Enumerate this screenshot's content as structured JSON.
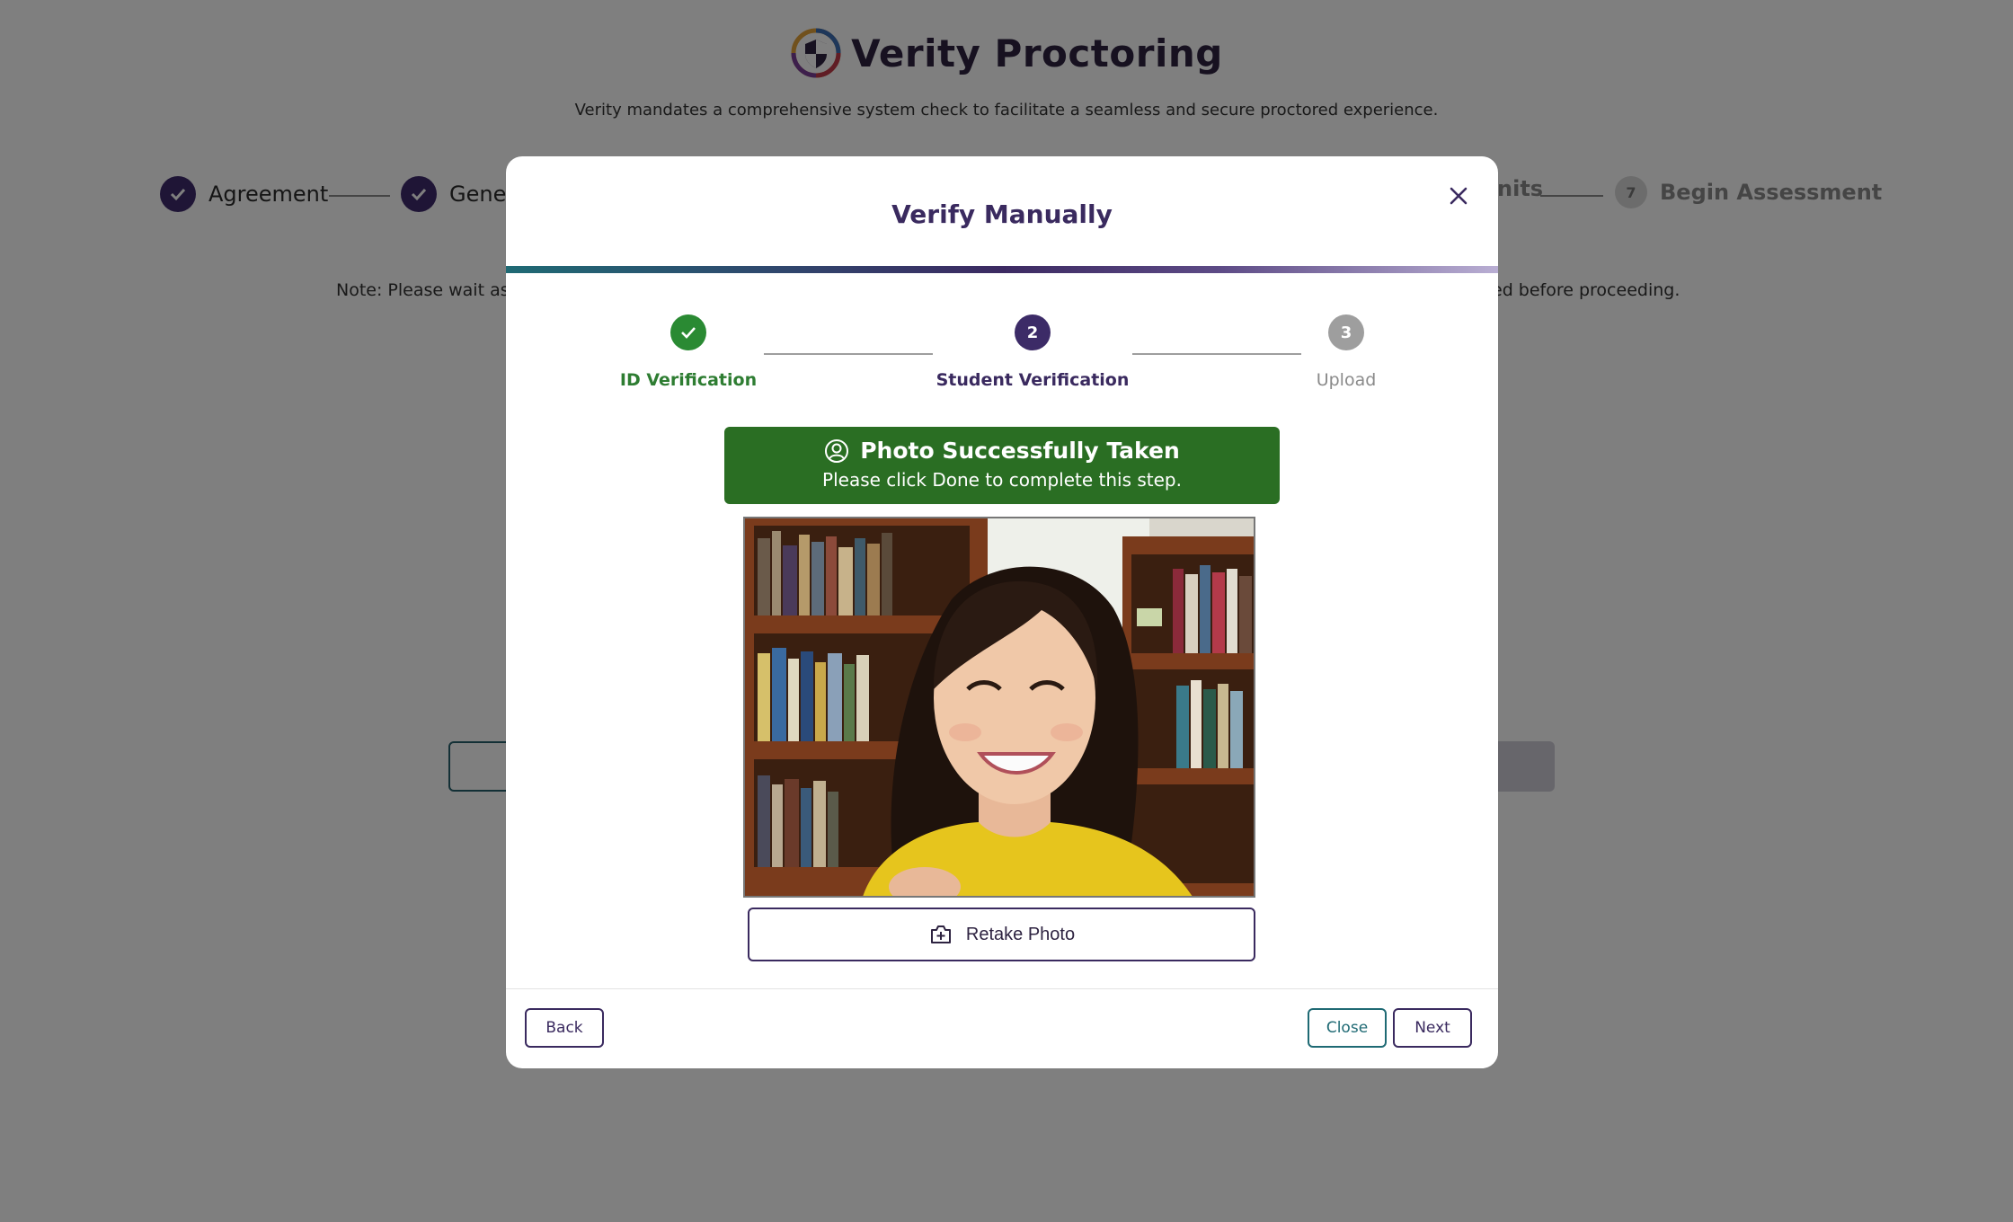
{
  "background": {
    "brand_name": "Verity Proctoring",
    "subtitle": "Verity mandates a comprehensive system check to facilitate a seamless and secure proctored experience.",
    "steps": [
      {
        "label": "Agreement",
        "state": "done"
      },
      {
        "label": "Gener",
        "state": "done"
      },
      {
        "label": "nits",
        "state": "partial"
      },
      {
        "label": "Begin Assessment",
        "number": "7",
        "state": "pending"
      }
    ],
    "note_left": "Note: Please wait as Ve",
    "note_right": "ed before proceeding."
  },
  "modal": {
    "title": "Verify Manually",
    "close_icon": "close-icon",
    "steps": [
      {
        "label": "ID Verification",
        "number": "1",
        "state": "done"
      },
      {
        "label": "Student Verification",
        "number": "2",
        "state": "active"
      },
      {
        "label": "Upload",
        "number": "3",
        "state": "pending"
      }
    ],
    "banner": {
      "icon": "user-circle-icon",
      "title": "Photo Successfully Taken",
      "subtitle": "Please click Done to complete this step."
    },
    "photo": {
      "description": "captured-student-photo"
    },
    "retake_button": {
      "label": "Retake Photo",
      "icon": "camera-plus-icon"
    },
    "footer": {
      "back_label": "Back",
      "close_label": "Close",
      "next_label": "Next"
    }
  },
  "colors": {
    "brand_purple": "#3a2a5f",
    "success_green": "#2a6e23",
    "step_done_green": "#2a8a33",
    "teal": "#1f6a74"
  }
}
